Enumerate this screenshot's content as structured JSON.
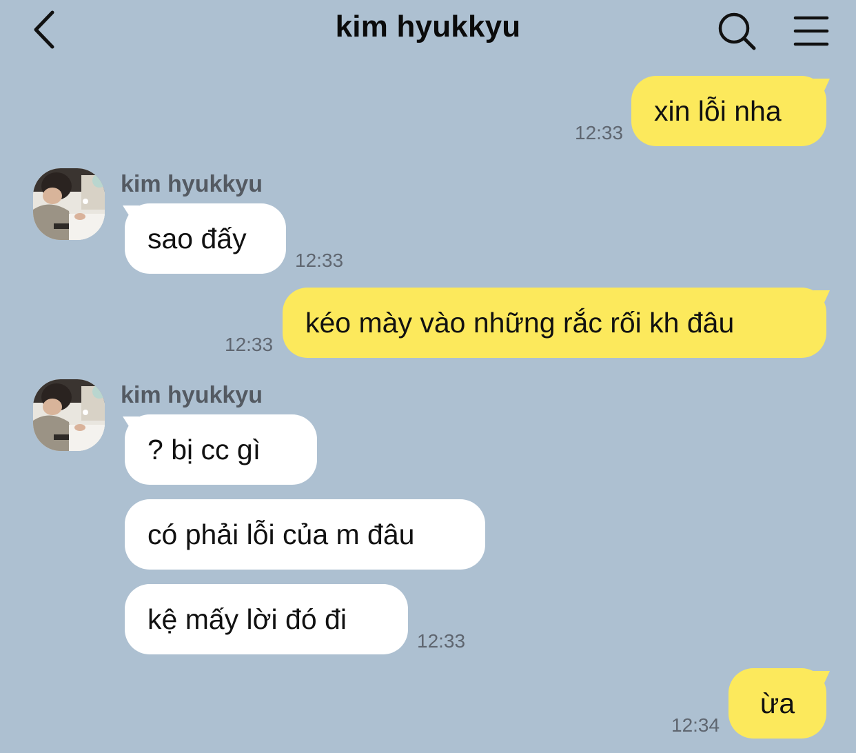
{
  "header": {
    "title": "kim hyukkyu"
  },
  "icons": {
    "back": "chevron-left-icon",
    "search": "search-icon",
    "menu": "hamburger-menu-icon"
  },
  "colors": {
    "background": "#adc0d1",
    "outgoing_bubble": "#fce95c",
    "incoming_bubble": "#ffffff"
  },
  "messages": [
    {
      "direction": "outgoing",
      "text": "xin lỗi nha",
      "time": "12:33"
    },
    {
      "direction": "incoming",
      "sender": "kim hyukkyu",
      "text": "sao đấy",
      "time": "12:33"
    },
    {
      "direction": "outgoing",
      "text": "kéo mày vào những rắc rối kh đâu",
      "time": "12:33"
    },
    {
      "direction": "incoming",
      "sender": "kim hyukkyu",
      "text": "? bị cc gì"
    },
    {
      "direction": "incoming",
      "text": "có phải lỗi của m đâu"
    },
    {
      "direction": "incoming",
      "text": "kệ mấy lời đó đi",
      "time": "12:33"
    },
    {
      "direction": "outgoing",
      "text": "ừa",
      "time": "12:34"
    }
  ]
}
